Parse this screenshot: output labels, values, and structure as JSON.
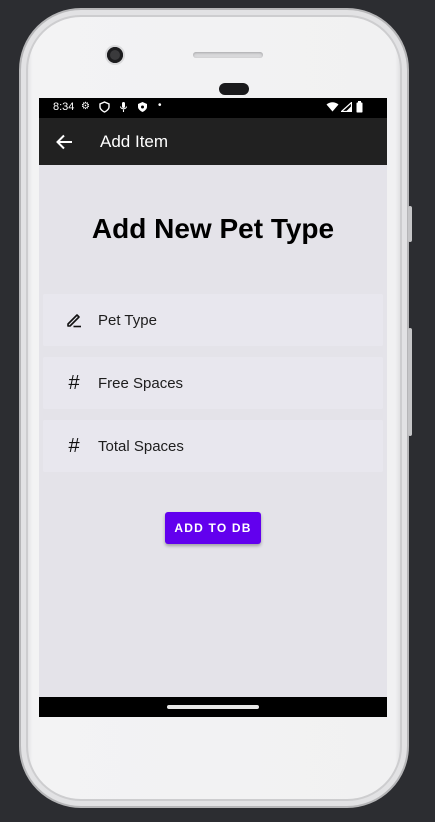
{
  "status_bar": {
    "time": "8:34",
    "icons": [
      "settings-icon",
      "shield-icon",
      "mic-icon",
      "vpn-shield-icon",
      "dot-icon",
      "wifi-icon",
      "signal-icon",
      "battery-icon"
    ]
  },
  "app_bar": {
    "title": "Add Item",
    "back_icon": "arrow-back-icon"
  },
  "form": {
    "heading": "Add New Pet Type",
    "fields": [
      {
        "placeholder": "Pet Type",
        "icon": "edit-icon"
      },
      {
        "placeholder": "Free Spaces",
        "icon": "hash-icon"
      },
      {
        "placeholder": "Total Spaces",
        "icon": "hash-icon"
      }
    ],
    "submit_label": "ADD TO DB"
  },
  "colors": {
    "accent": "#6200ee",
    "app_bar": "#212121",
    "background": "#e4e3e9",
    "field": "#e8e7ee"
  }
}
